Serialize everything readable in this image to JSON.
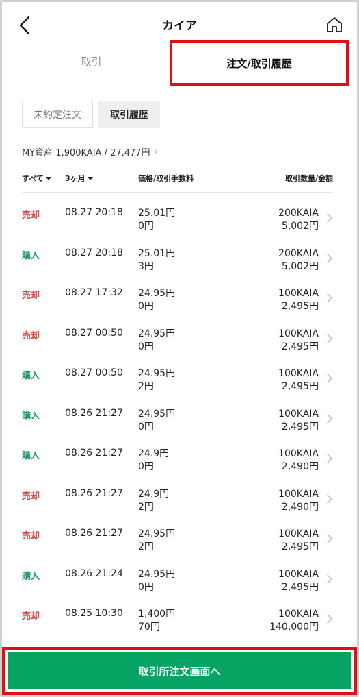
{
  "header": {
    "title": "カイア"
  },
  "tabs": [
    {
      "label": "取引"
    },
    {
      "label": "注文/取引履歴"
    }
  ],
  "subtabs": [
    {
      "label": "未約定注文"
    },
    {
      "label": "取引履歴"
    }
  ],
  "assets": {
    "text": "MY資産 1,900KAIA / 27,477円"
  },
  "columns": {
    "all": "すべて",
    "period": "3ヶ月",
    "price": "価格/取引手数料",
    "qty": "取引数量/金額"
  },
  "rows": [
    {
      "side": "売却",
      "type": "sell",
      "date": "08.27 20:18",
      "price": "25.01円",
      "fee": "0円",
      "qty": "200KAIA",
      "amount": "5,002円"
    },
    {
      "side": "購入",
      "type": "buy",
      "date": "08.27 20:18",
      "price": "25.01円",
      "fee": "3円",
      "qty": "200KAIA",
      "amount": "5,002円"
    },
    {
      "side": "売却",
      "type": "sell",
      "date": "08.27 17:32",
      "price": "24.95円",
      "fee": "0円",
      "qty": "100KAIA",
      "amount": "2,495円"
    },
    {
      "side": "売却",
      "type": "sell",
      "date": "08.27 00:50",
      "price": "24.95円",
      "fee": "0円",
      "qty": "100KAIA",
      "amount": "2,495円"
    },
    {
      "side": "購入",
      "type": "buy",
      "date": "08.27 00:50",
      "price": "24.95円",
      "fee": "2円",
      "qty": "100KAIA",
      "amount": "2,495円"
    },
    {
      "side": "購入",
      "type": "buy",
      "date": "08.26 21:27",
      "price": "24.95円",
      "fee": "0円",
      "qty": "100KAIA",
      "amount": "2,495円"
    },
    {
      "side": "購入",
      "type": "buy",
      "date": "08.26 21:27",
      "price": "24.9円",
      "fee": "0円",
      "qty": "100KAIA",
      "amount": "2,490円"
    },
    {
      "side": "売却",
      "type": "sell",
      "date": "08.26 21:27",
      "price": "24.9円",
      "fee": "2円",
      "qty": "100KAIA",
      "amount": "2,490円"
    },
    {
      "side": "売却",
      "type": "sell",
      "date": "08.26 21:27",
      "price": "24.95円",
      "fee": "2円",
      "qty": "100KAIA",
      "amount": "2,495円"
    },
    {
      "side": "購入",
      "type": "buy",
      "date": "08.26 21:24",
      "price": "24.95円",
      "fee": "0円",
      "qty": "100KAIA",
      "amount": "2,495円"
    },
    {
      "side": "売却",
      "type": "sell",
      "date": "08.25 10:30",
      "price": "1,400円",
      "fee": "70円",
      "qty": "100KAIA",
      "amount": "140,000円"
    }
  ],
  "cta": {
    "label": "取引所注文画面へ"
  },
  "colors": {
    "sell": "#d24b4b",
    "buy": "#16965a",
    "cta": "#06a463",
    "highlight": "#e01010"
  },
  "icons": {
    "back": "chevron-left-icon",
    "home": "home-icon",
    "row": "chevron-right-icon"
  }
}
